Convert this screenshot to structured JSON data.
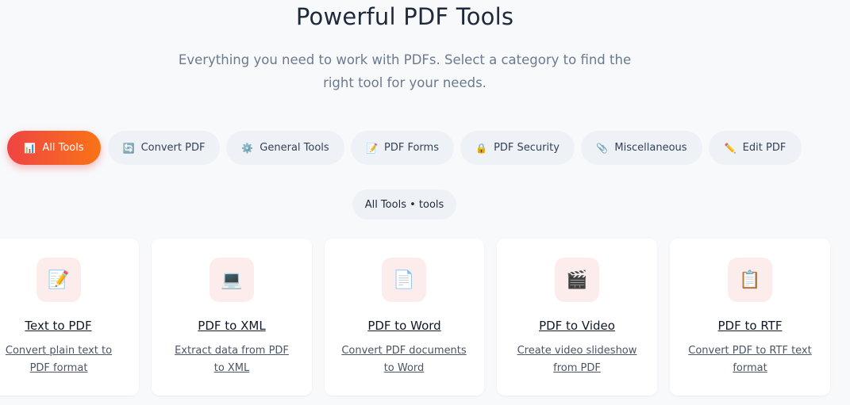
{
  "header": {
    "title": "Powerful PDF Tools",
    "subtitle": "Everything you need to work with PDFs. Select a category to find the right tool for your needs."
  },
  "tabs": [
    {
      "label": "All Tools",
      "icon": "📊",
      "icon_name": "chart-icon",
      "active": true
    },
    {
      "label": "Convert PDF",
      "icon": "🔄",
      "icon_name": "refresh-icon"
    },
    {
      "label": "General Tools",
      "icon": "⚙️",
      "icon_name": "gear-icon"
    },
    {
      "label": "PDF Forms",
      "icon": "📝",
      "icon_name": "memo-icon"
    },
    {
      "label": "PDF Security",
      "icon": "🔒",
      "icon_name": "lock-icon"
    },
    {
      "label": "Miscellaneous",
      "icon": "📎",
      "icon_name": "paperclip-icon"
    },
    {
      "label": "Edit PDF",
      "icon": "✏️",
      "icon_name": "pencil-icon"
    }
  ],
  "summary": {
    "text": "All Tools • tools"
  },
  "tools": [
    {
      "name": "Text to PDF",
      "description": "Convert plain text to PDF format",
      "icon": "📝",
      "icon_name": "memo-icon"
    },
    {
      "name": "PDF to XML",
      "description": "Extract data from PDF to XML",
      "icon": "💻",
      "icon_name": "laptop-icon"
    },
    {
      "name": "PDF to Word",
      "description": "Convert PDF documents to Word",
      "icon": "📄",
      "icon_name": "document-icon"
    },
    {
      "name": "PDF to Video",
      "description": "Create video slideshow from PDF",
      "icon": "🎬",
      "icon_name": "clapper-icon"
    },
    {
      "name": "PDF to RTF",
      "description": "Convert PDF to RTF text format",
      "icon": "📋",
      "icon_name": "clipboard-icon"
    }
  ],
  "colors": {
    "accent_start": "#ef4444",
    "accent_end": "#f97316",
    "icon_bg": "#fdecec"
  }
}
